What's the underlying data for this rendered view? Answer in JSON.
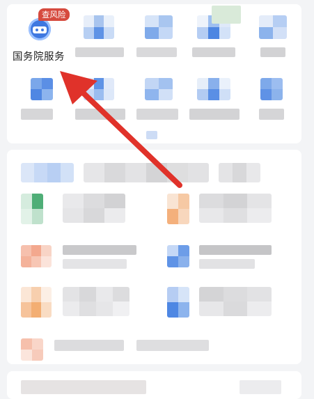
{
  "featured_service": {
    "label": "国务院服务",
    "badge": "查风险",
    "icon": "government-service-icon"
  },
  "colors": {
    "arrow": "#e0322a",
    "badge": "#d64a3e",
    "icon_blue": "#3f78e0",
    "page_bg": "#f3f4f6"
  }
}
